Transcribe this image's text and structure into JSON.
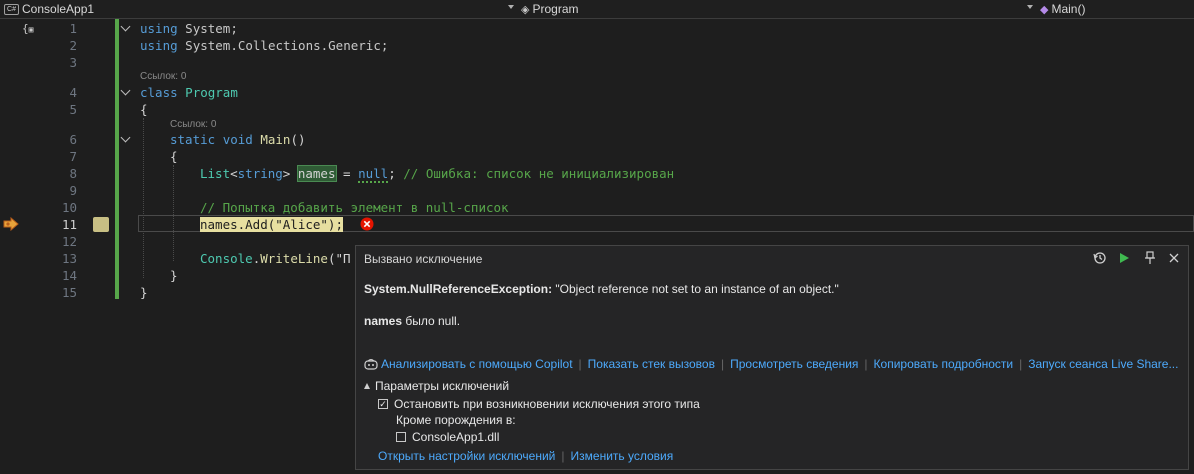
{
  "nav": {
    "project": "ConsoleApp1",
    "project_icon": "C#",
    "class_name": "Program",
    "member": "Main()"
  },
  "code": {
    "line_numbers": [
      "1",
      "2",
      "3",
      "4",
      "5",
      "6",
      "7",
      "8",
      "9",
      "10",
      "11",
      "12",
      "13",
      "14",
      "15"
    ],
    "current_line": "11",
    "ref_label": "Ссылок: 0",
    "l1_kw": "using",
    "l1_ns": "System;",
    "l2_kw": "using",
    "l2_ns": "System.Collections.Generic;",
    "l4_kw": "class",
    "l4_type": "Program",
    "l5": "{",
    "l6_static": "static",
    "l6_void": "void",
    "l6_name": "Main",
    "l6_parens": "()",
    "l7": "{",
    "l8_type": "List",
    "l8_lt": "<",
    "l8_kw": "string",
    "l8_gt": ">",
    "l8_var": "names",
    "l8_eq": " = ",
    "l8_null": "null",
    "l8_semi": ";",
    "l8_comment": " // Ошибка: список не инициализирован",
    "l10_comment": "// Попытка добавить элемент в null-список",
    "l11_stmt": "names.Add(\"Alice\");",
    "l13_cls": "Console",
    "l13_dot": ".",
    "l13_fn": "WriteLine",
    "l13_rest": "(\"П",
    "l14": "}",
    "l15": "}"
  },
  "exception_popup": {
    "title": "Вызвано исключение",
    "exception_type": "System.NullReferenceException:",
    "exception_message": " \"Object reference not set to an instance of an object.\"",
    "null_var": "names",
    "null_text": " было null.",
    "links": [
      "Анализировать с помощью Copilot",
      "Показать стек вызовов",
      "Просмотреть сведения",
      "Копировать подробности",
      "Запуск сеанса Live Share..."
    ],
    "settings_header": "Параметры исключений",
    "break_when_thrown": "Остановить при возникновении исключения этого типа",
    "break_checked": true,
    "except_from": "Кроме порождения в:",
    "module": "ConsoleApp1.dll",
    "module_checked": false,
    "footer_links": [
      "Открыть настройки исключений",
      "Изменить условия"
    ]
  },
  "colors": {
    "keyword": "#569cd6",
    "type": "#4ec9b0",
    "method": "#dcdcaa",
    "string": "#d69d85",
    "comment": "#57a64a",
    "link": "#4daafc",
    "error": "#e51400",
    "changes_bar": "#57a64a"
  }
}
